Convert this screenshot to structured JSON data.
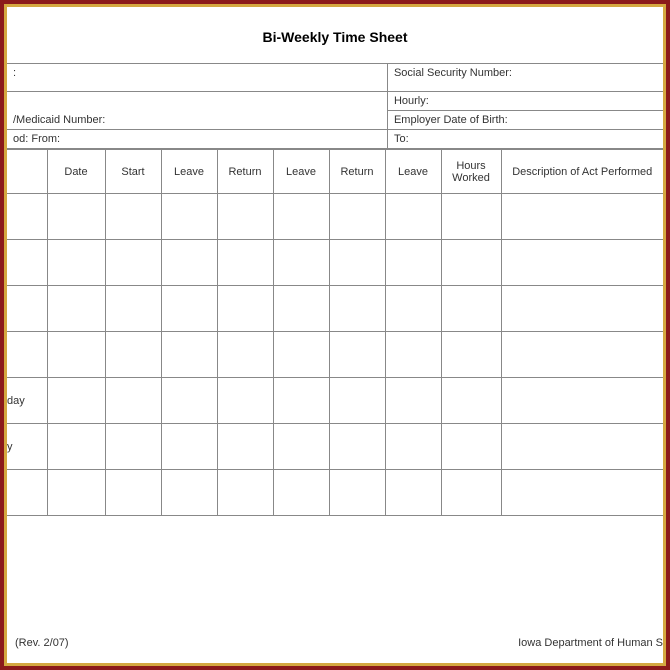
{
  "title": "Bi-Weekly Time Sheet",
  "info": {
    "row1_left_suffix": ":",
    "ssn": "Social Security Number:",
    "medicaid": "/Medicaid Number:",
    "hourly": "Hourly:",
    "from": "od:  From:",
    "employer_dob": "Employer Date of Birth:",
    "to": "To:"
  },
  "headers": {
    "day": "",
    "date": "Date",
    "start": "Start",
    "leave1": "Leave",
    "return1": "Return",
    "leave2": "Leave",
    "return2": "Return",
    "leave3": "Leave",
    "hours": "Hours Worked",
    "desc": "Description of Act Performed"
  },
  "rows": [
    {
      "day": ""
    },
    {
      "day": ""
    },
    {
      "day": ""
    },
    {
      "day": ""
    },
    {
      "day": "day"
    },
    {
      "day": "y"
    },
    {
      "day": ""
    }
  ],
  "footer": {
    "rev": "(Rev. 2/07)",
    "dept": "Iowa Department of Human S"
  }
}
